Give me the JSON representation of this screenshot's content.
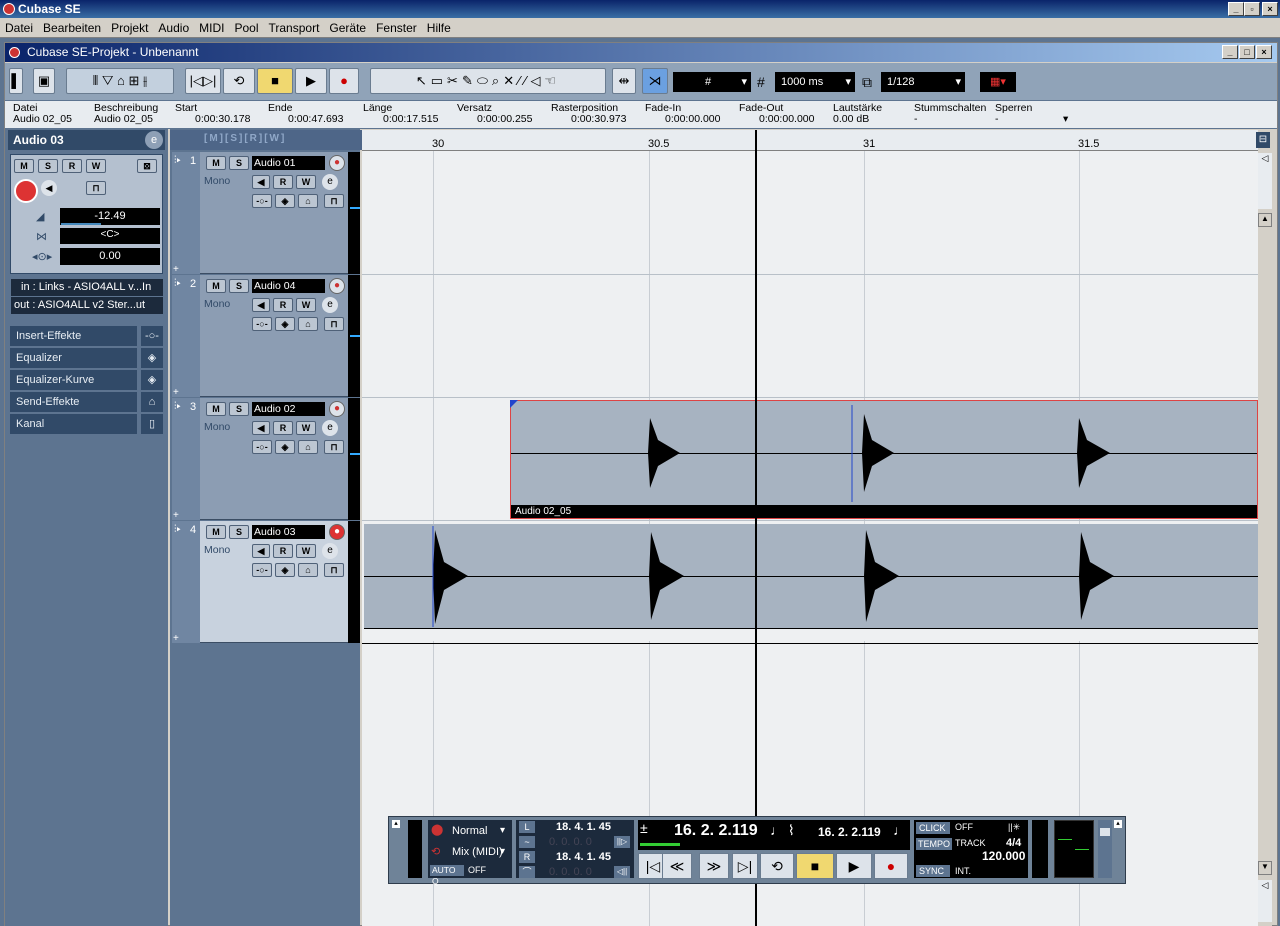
{
  "app": {
    "title": "Cubase SE"
  },
  "menu": [
    "Datei",
    "Bearbeiten",
    "Projekt",
    "Audio",
    "MIDI",
    "Pool",
    "Transport",
    "Geräte",
    "Fenster",
    "Hilfe"
  ],
  "project": {
    "title": "Cubase SE-Projekt - Unbenannt"
  },
  "toolbar": {
    "grid_mode": "#",
    "quantize_length": "1000 ms",
    "quantize": "1/128"
  },
  "infoline": {
    "headers": [
      "Datei",
      "Beschreibung",
      "Start",
      "Ende",
      "Länge",
      "Versatz",
      "Rasterposition",
      "Fade-In",
      "Fade-Out",
      "Lautstärke",
      "Stummschalten",
      "Sperren"
    ],
    "values": [
      "Audio 02_05",
      "Audio 02_05",
      "0:00:30.178",
      "0:00:47.693",
      "0:00:17.515",
      "0:00:00.255",
      "0:00:30.973",
      "0:00:00.000",
      "0:00:00.000",
      "0.00 dB",
      "-",
      "-"
    ]
  },
  "inspector": {
    "track_name": "Audio 03",
    "volume": "-12.49",
    "pan": "<C>",
    "delay": "0.00",
    "input": "in : Links - ASIO4ALL v...In",
    "output": "out : ASIO4ALL v2 Ster...ut",
    "sections": [
      "Insert-Effekte",
      "Equalizer",
      "Equalizer-Kurve",
      "Send-Effekte",
      "Kanal"
    ]
  },
  "tracks": [
    {
      "num": "1",
      "name": "Audio 01",
      "mode": "Mono"
    },
    {
      "num": "2",
      "name": "Audio 04",
      "mode": "Mono"
    },
    {
      "num": "3",
      "name": "Audio 02",
      "mode": "Mono"
    },
    {
      "num": "4",
      "name": "Audio 03",
      "mode": "Mono"
    }
  ],
  "ruler": [
    "30",
    "30.5",
    "31",
    "31.5"
  ],
  "event": {
    "name": "Audio 02_05"
  },
  "transport": {
    "mode": "Normal",
    "mix": "Mix (MIDI)",
    "autoq": "AUTO Q",
    "autoq_value": "OFF",
    "left_locator": "18. 4. 1. 45",
    "right_locator": "18. 4. 1. 45",
    "zero": "0. 0. 0. 0",
    "primary_time": "16. 2. 2.119",
    "secondary_time": "16. 2. 2.119",
    "click": "CLICK",
    "click_value": "OFF",
    "tempo": "TEMPO",
    "track": "TRACK",
    "signature": "4/4",
    "tempo_value": "120.000",
    "sync": "SYNC",
    "sync_value": "INT."
  }
}
